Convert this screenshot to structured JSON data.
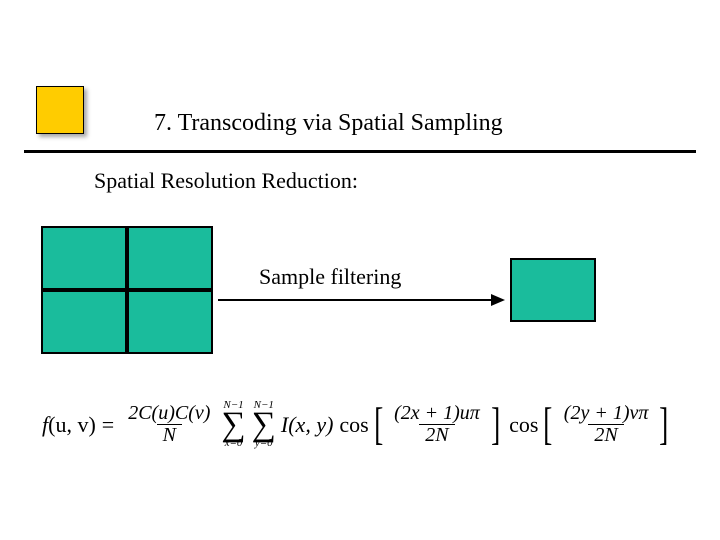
{
  "title": "7. Transcoding via Spatial Sampling",
  "subtitle": "Spatial Resolution Reduction:",
  "sample_label": "Sample filtering",
  "formula": {
    "lhs_f": "f",
    "lhs_args": "(u, v)",
    "equals": "=",
    "frac1_num": "2C(u)C(v)",
    "frac1_den": "N",
    "sum1_top": "N−1",
    "sum1_bot": "x=0",
    "sum2_top": "N−1",
    "sum2_bot": "y=0",
    "Ixy": "I(x, y)",
    "cos_a": "cos",
    "bracket_a_num": "(2x + 1)uπ",
    "bracket_a_den": "2N",
    "cos_b": "cos",
    "bracket_b_num": "(2y + 1)vπ",
    "bracket_b_den": "2N"
  }
}
